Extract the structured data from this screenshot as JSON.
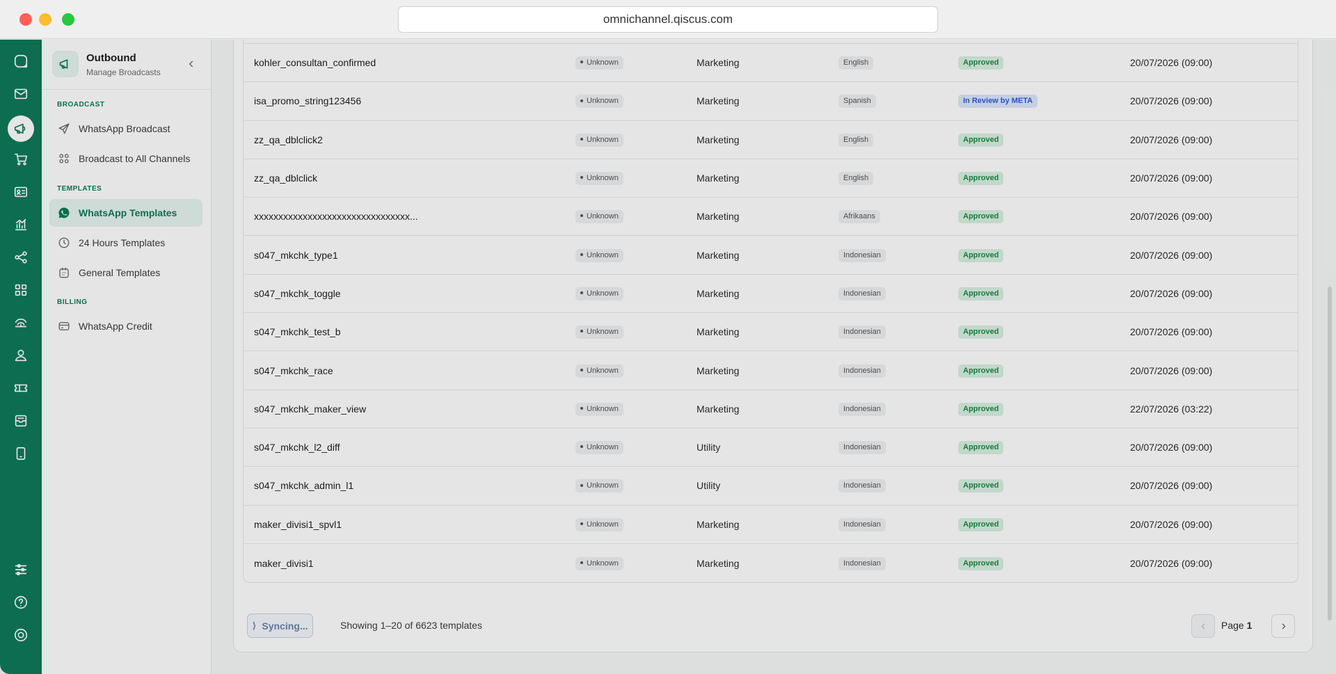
{
  "browser": {
    "url": "omnichannel.qiscus.com"
  },
  "sidebar": {
    "title": "Outbound",
    "subtitle": "Manage Broadcasts",
    "sections": {
      "broadcast": "BROADCAST",
      "templates": "TEMPLATES",
      "billing": "BILLING"
    },
    "items": {
      "whatsapp_broadcast": "WhatsApp Broadcast",
      "broadcast_all": "Broadcast to All Channels",
      "whatsapp_templates": "WhatsApp Templates",
      "hours_templates": "24 Hours Templates",
      "general_templates": "General Templates",
      "whatsapp_credit": "WhatsApp Credit"
    }
  },
  "rail_icons": [
    "chat-icon",
    "mail-icon",
    "megaphone-icon",
    "cart-icon",
    "contact-card-icon",
    "analytics-icon",
    "flow-icon",
    "apps-grid-icon",
    "signal-icon",
    "user-icon",
    "ticket-icon",
    "inbox-icon",
    "mobile-icon",
    "settings-sliders-icon",
    "help-icon",
    "power-icon"
  ],
  "table": {
    "rows": [
      {
        "name": "kohler_consultan_confirmed",
        "quality": "Unknown",
        "category": "Marketing",
        "language": "English",
        "status": "Approved",
        "status_type": "approved",
        "date": "20/07/2026 (09:00)"
      },
      {
        "name": "isa_promo_string123456",
        "quality": "Unknown",
        "category": "Marketing",
        "language": "Spanish",
        "status": "In Review by META",
        "status_type": "review",
        "date": "20/07/2026 (09:00)"
      },
      {
        "name": "zz_qa_dblclick2",
        "quality": "Unknown",
        "category": "Marketing",
        "language": "English",
        "status": "Approved",
        "status_type": "approved",
        "date": "20/07/2026 (09:00)"
      },
      {
        "name": "zz_qa_dblclick",
        "quality": "Unknown",
        "category": "Marketing",
        "language": "English",
        "status": "Approved",
        "status_type": "approved",
        "date": "20/07/2026 (09:00)"
      },
      {
        "name": "xxxxxxxxxxxxxxxxxxxxxxxxxxxxxxxx...",
        "quality": "Unknown",
        "category": "Marketing",
        "language": "Afrikaans",
        "status": "Approved",
        "status_type": "approved",
        "date": "20/07/2026 (09:00)"
      },
      {
        "name": "s047_mkchk_type1",
        "quality": "Unknown",
        "category": "Marketing",
        "language": "Indonesian",
        "status": "Approved",
        "status_type": "approved",
        "date": "20/07/2026 (09:00)"
      },
      {
        "name": "s047_mkchk_toggle",
        "quality": "Unknown",
        "category": "Marketing",
        "language": "Indonesian",
        "status": "Approved",
        "status_type": "approved",
        "date": "20/07/2026 (09:00)"
      },
      {
        "name": "s047_mkchk_test_b",
        "quality": "Unknown",
        "category": "Marketing",
        "language": "Indonesian",
        "status": "Approved",
        "status_type": "approved",
        "date": "20/07/2026 (09:00)"
      },
      {
        "name": "s047_mkchk_race",
        "quality": "Unknown",
        "category": "Marketing",
        "language": "Indonesian",
        "status": "Approved",
        "status_type": "approved",
        "date": "20/07/2026 (09:00)"
      },
      {
        "name": "s047_mkchk_maker_view",
        "quality": "Unknown",
        "category": "Marketing",
        "language": "Indonesian",
        "status": "Approved",
        "status_type": "approved",
        "date": "22/07/2026 (03:22)"
      },
      {
        "name": "s047_mkchk_l2_diff",
        "quality": "Unknown",
        "category": "Utility",
        "language": "Indonesian",
        "status": "Approved",
        "status_type": "approved",
        "date": "20/07/2026 (09:00)"
      },
      {
        "name": "s047_mkchk_admin_l1",
        "quality": "Unknown",
        "category": "Utility",
        "language": "Indonesian",
        "status": "Approved",
        "status_type": "approved",
        "date": "20/07/2026 (09:00)"
      },
      {
        "name": "maker_divisi1_spvl1",
        "quality": "Unknown",
        "category": "Marketing",
        "language": "Indonesian",
        "status": "Approved",
        "status_type": "approved",
        "date": "20/07/2026 (09:00)"
      },
      {
        "name": "maker_divisi1",
        "quality": "Unknown",
        "category": "Marketing",
        "language": "Indonesian",
        "status": "Approved",
        "status_type": "approved",
        "date": "20/07/2026 (09:00)"
      }
    ]
  },
  "footer": {
    "sync_label": "Syncing...",
    "showing": "Showing 1–20 of 6623 templates",
    "page_prefix": "Page",
    "page_number": "1"
  },
  "colors": {
    "brand": "#0e7a5a",
    "approved": "#1a8a45",
    "review": "#2d5ed6"
  }
}
